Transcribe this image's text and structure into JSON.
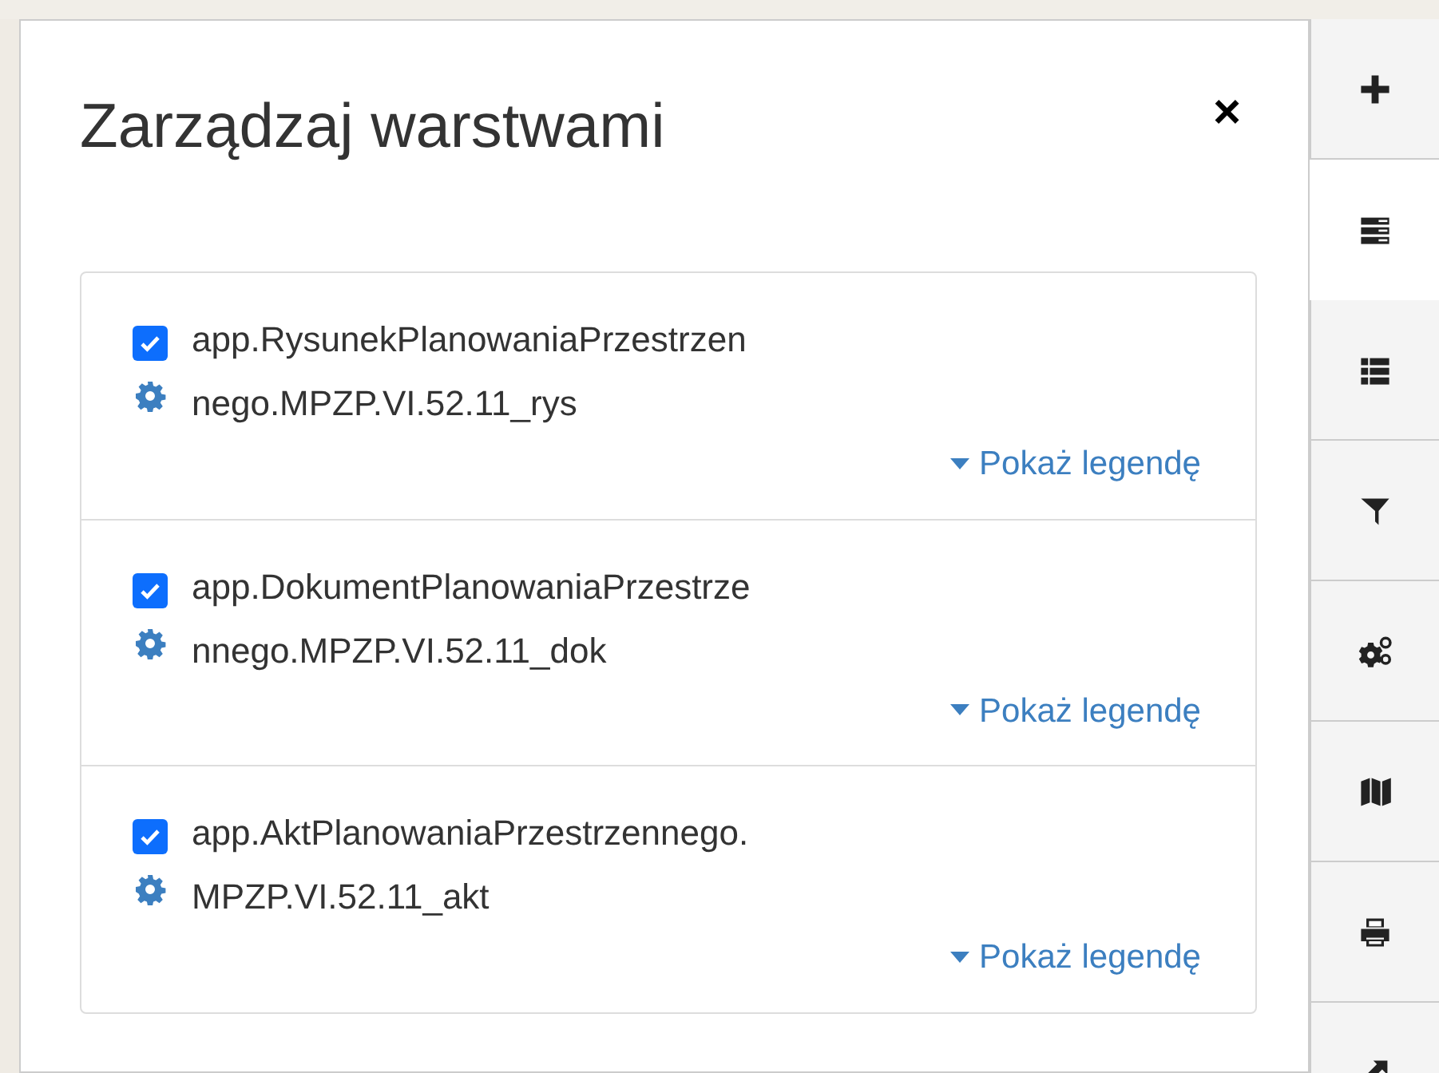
{
  "panel": {
    "title": "Zarządzaj warstwami",
    "close": "×"
  },
  "layers": [
    {
      "name": "app.RysunekPlanowaniaPrzestrzennego.MPZP.VI.52.11_rys",
      "checked": true,
      "legend": "Pokaż legendę"
    },
    {
      "name": "app.DokumentPlanowaniaPrzestrzennego.MPZP.VI.52.11_dok",
      "checked": true,
      "legend": "Pokaż legendę"
    },
    {
      "name": "app.AktPlanowaniaPrzestrzennego.MPZP.VI.52.11_akt",
      "checked": true,
      "legend": "Pokaż legendę"
    }
  ],
  "toolbar": [
    {
      "selected": false
    },
    {
      "selected": true
    },
    {
      "selected": false
    },
    {
      "selected": false
    },
    {
      "selected": false
    },
    {
      "selected": false
    },
    {
      "selected": false
    },
    {
      "selected": false
    }
  ]
}
